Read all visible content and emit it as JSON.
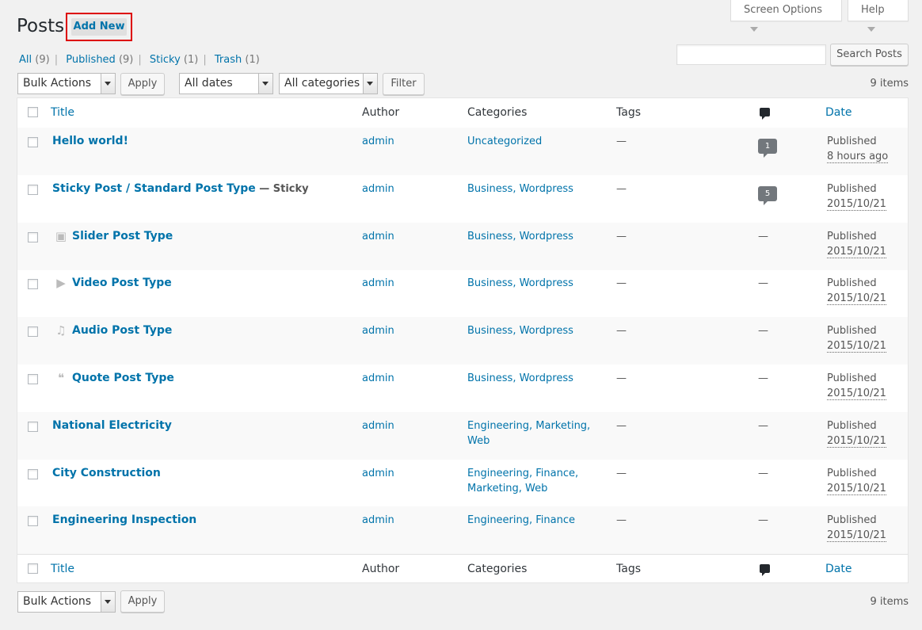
{
  "top_tabs": {
    "screen_options": "Screen Options",
    "help": "Help"
  },
  "header": {
    "title": "Posts",
    "add_new": "Add New"
  },
  "filters_nav": [
    {
      "label": "All",
      "count": "(9)"
    },
    {
      "label": "Published",
      "count": "(9)"
    },
    {
      "label": "Sticky",
      "count": "(1)"
    },
    {
      "label": "Trash",
      "count": "(1)"
    }
  ],
  "search": {
    "button": "Search Posts",
    "value": ""
  },
  "tablenav": {
    "bulk_actions": "Bulk Actions",
    "apply": "Apply",
    "dates": "All dates",
    "categories": "All categories",
    "filter": "Filter",
    "items": "9 items"
  },
  "columns": {
    "title": "Title",
    "author": "Author",
    "categories": "Categories",
    "tags": "Tags",
    "date": "Date"
  },
  "posts": [
    {
      "title": "Hello world!",
      "sticky": "",
      "author": "admin",
      "categories": "Uncategorized",
      "tags": "—",
      "comments": "1",
      "status": "Published",
      "when": "8 hours ago",
      "format_icon": ""
    },
    {
      "title": "Sticky Post / Standard Post Type",
      "sticky": " — Sticky",
      "author": "admin",
      "categories": "Business, Wordpress",
      "tags": "—",
      "comments": "5",
      "status": "Published",
      "when": "2015/10/21",
      "format_icon": ""
    },
    {
      "title": "Slider Post Type",
      "sticky": "",
      "author": "admin",
      "categories": "Business, Wordpress",
      "tags": "—",
      "comments": "—",
      "status": "Published",
      "when": "2015/10/21",
      "format_icon": "gallery-icon"
    },
    {
      "title": "Video Post Type",
      "sticky": "",
      "author": "admin",
      "categories": "Business, Wordpress",
      "tags": "—",
      "comments": "—",
      "status": "Published",
      "when": "2015/10/21",
      "format_icon": "video-icon"
    },
    {
      "title": "Audio Post Type",
      "sticky": "",
      "author": "admin",
      "categories": "Business, Wordpress",
      "tags": "—",
      "comments": "—",
      "status": "Published",
      "when": "2015/10/21",
      "format_icon": "audio-icon"
    },
    {
      "title": "Quote Post Type",
      "sticky": "",
      "author": "admin",
      "categories": "Business, Wordpress",
      "tags": "—",
      "comments": "—",
      "status": "Published",
      "when": "2015/10/21",
      "format_icon": "quote-icon"
    },
    {
      "title": "National Electricity",
      "sticky": "",
      "author": "admin",
      "categories": "Engineering, Marketing, Web",
      "tags": "—",
      "comments": "—",
      "status": "Published",
      "when": "2015/10/21",
      "format_icon": ""
    },
    {
      "title": "City Construction",
      "sticky": "",
      "author": "admin",
      "categories": "Engineering, Finance, Marketing, Web",
      "tags": "—",
      "comments": "—",
      "status": "Published",
      "when": "2015/10/21",
      "format_icon": ""
    },
    {
      "title": "Engineering Inspection",
      "sticky": "",
      "author": "admin",
      "categories": "Engineering, Finance",
      "tags": "—",
      "comments": "—",
      "status": "Published",
      "when": "2015/10/21",
      "format_icon": ""
    }
  ],
  "colors": {
    "link": "#0073aa",
    "highlight_border": "#dd0000",
    "bubble": "#72777c"
  }
}
